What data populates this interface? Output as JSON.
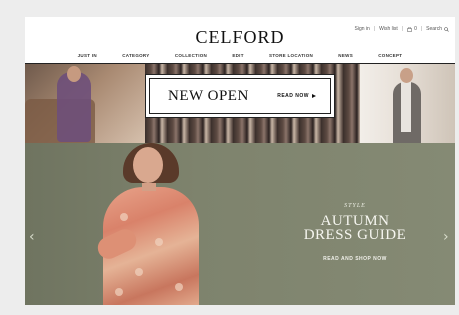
{
  "brand": {
    "logo": "CELFORD"
  },
  "utility_nav": {
    "signin": "Sign in",
    "wishlist": "Wish list",
    "cart_count": "0",
    "search": "Search"
  },
  "main_nav": {
    "items": [
      "JUST IN",
      "CATEGORY",
      "COLLECTION",
      "EDIT",
      "STORE LOCATION",
      "NEWS",
      "CONCEPT"
    ]
  },
  "promo_banner": {
    "title": "NEW OPEN",
    "cta": "READ NOW"
  },
  "hero": {
    "eyebrow": "STYLE",
    "headline_line1": "AUTUMN",
    "headline_line2": "DRESS GUIDE",
    "cta": "READ AND SHOP NOW",
    "prev_arrow": "‹",
    "next_arrow": "›"
  },
  "icons": {
    "cart": "bag-icon",
    "search": "search-icon",
    "prev": "chevron-left-icon",
    "next": "chevron-right-icon"
  }
}
